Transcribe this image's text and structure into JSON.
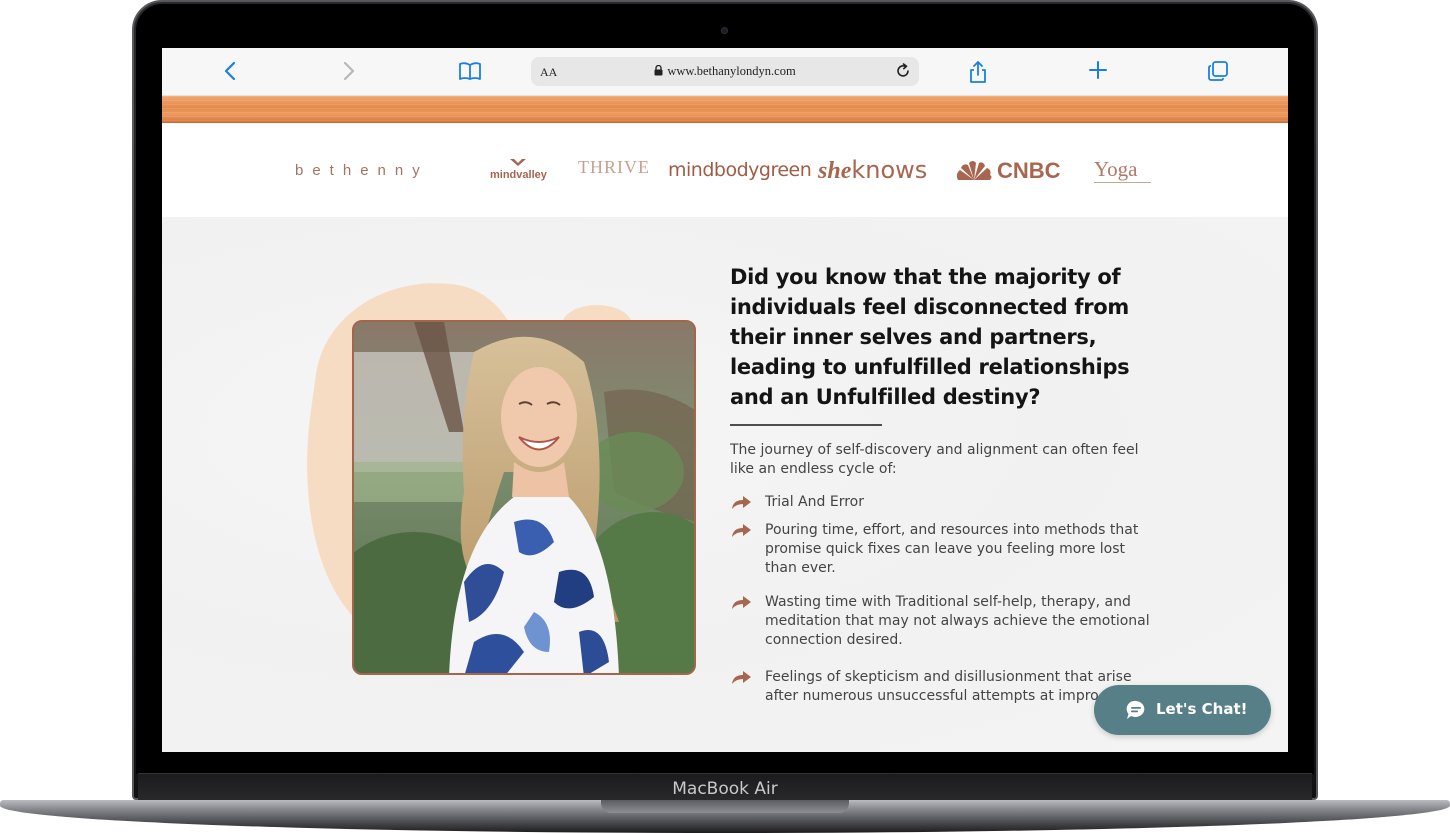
{
  "device": {
    "model_label": "MacBook Air"
  },
  "browser": {
    "address_aa": "AA",
    "url": "www.bethanylondyn.com",
    "buttons": [
      "back-icon",
      "forward-icon",
      "bookmarks-icon",
      "reload-icon",
      "share-icon",
      "new-tab-icon",
      "tabs-icon"
    ]
  },
  "press_logos": [
    {
      "name": "bethenny",
      "text": "bethenny"
    },
    {
      "name": "mindvalley",
      "text": "mindvalley"
    },
    {
      "name": "thrive-global",
      "text": "THRIVE"
    },
    {
      "name": "mindbodygreen",
      "text": "mindbodygreen"
    },
    {
      "name": "sheknows",
      "text_a": "she",
      "text_b": "knows"
    },
    {
      "name": "cnbc",
      "text": "CNBC"
    },
    {
      "name": "yoga-journal",
      "text": "Yoga"
    }
  ],
  "main": {
    "headline": "Did you know that the majority of individuals feel disconnected from their inner selves and partners, leading to unfulfilled relationships and an Unfulfilled destiny?",
    "intro": "The journey of self-discovery and alignment can often feel like an endless cycle of:",
    "bullets": [
      "Trial And Error",
      "Pouring time, effort, and resources into methods that promise quick fixes can leave you feeling more lost than ever.",
      "Wasting time with Traditional self-help, therapy, and meditation that may not always achieve the emotional connection desired.",
      "Feelings of skepticism and disillusionment that arise after numerous unsuccessful attempts at impro"
    ]
  },
  "chat_widget": {
    "label": "Let's Chat!"
  },
  "colors": {
    "accent_copper": "#a7664f",
    "wood_orange": "#e58a4e",
    "chat_teal": "#577f87",
    "blob_peach": "#f7dcc4"
  }
}
